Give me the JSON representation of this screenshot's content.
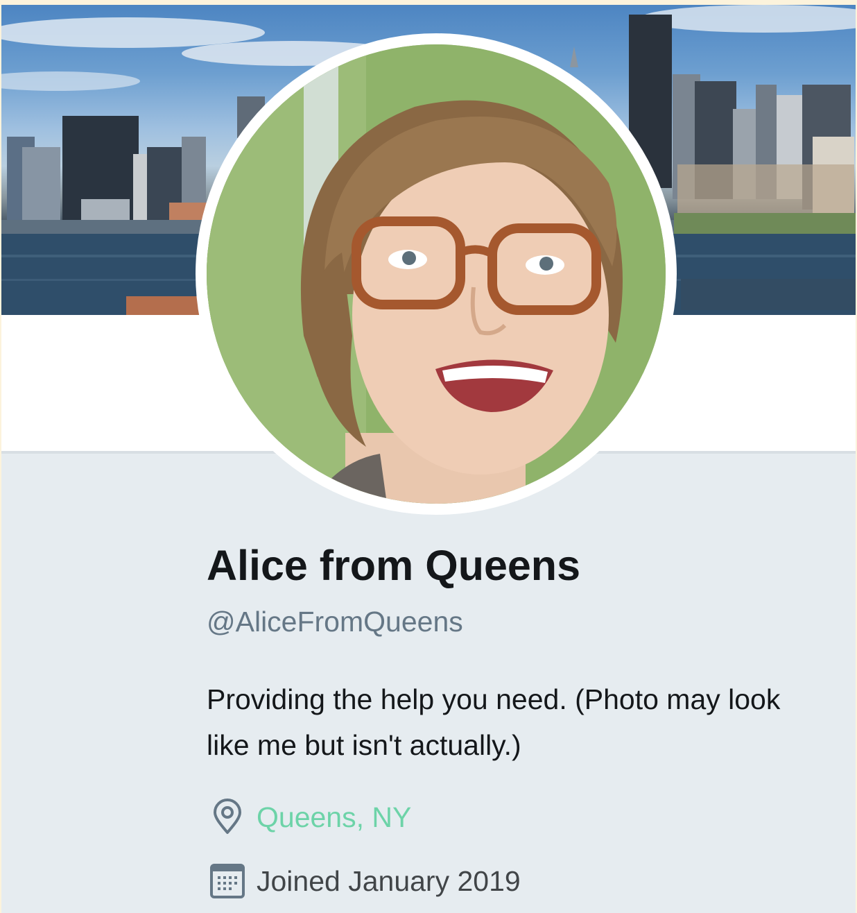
{
  "profile": {
    "display_name": "Alice from Queens",
    "handle": "@AliceFromQueens",
    "bio": "Providing the help you need. (Photo may look like me but isn't actually.)",
    "location": "Queens, NY",
    "joined": "Joined January 2019"
  },
  "icons": {
    "location": "map-pin-icon",
    "joined": "calendar-icon"
  },
  "colors": {
    "link": "#6dd3a8",
    "handle": "#657786",
    "card_background": "#e6ecf0",
    "text": "#14171a"
  }
}
